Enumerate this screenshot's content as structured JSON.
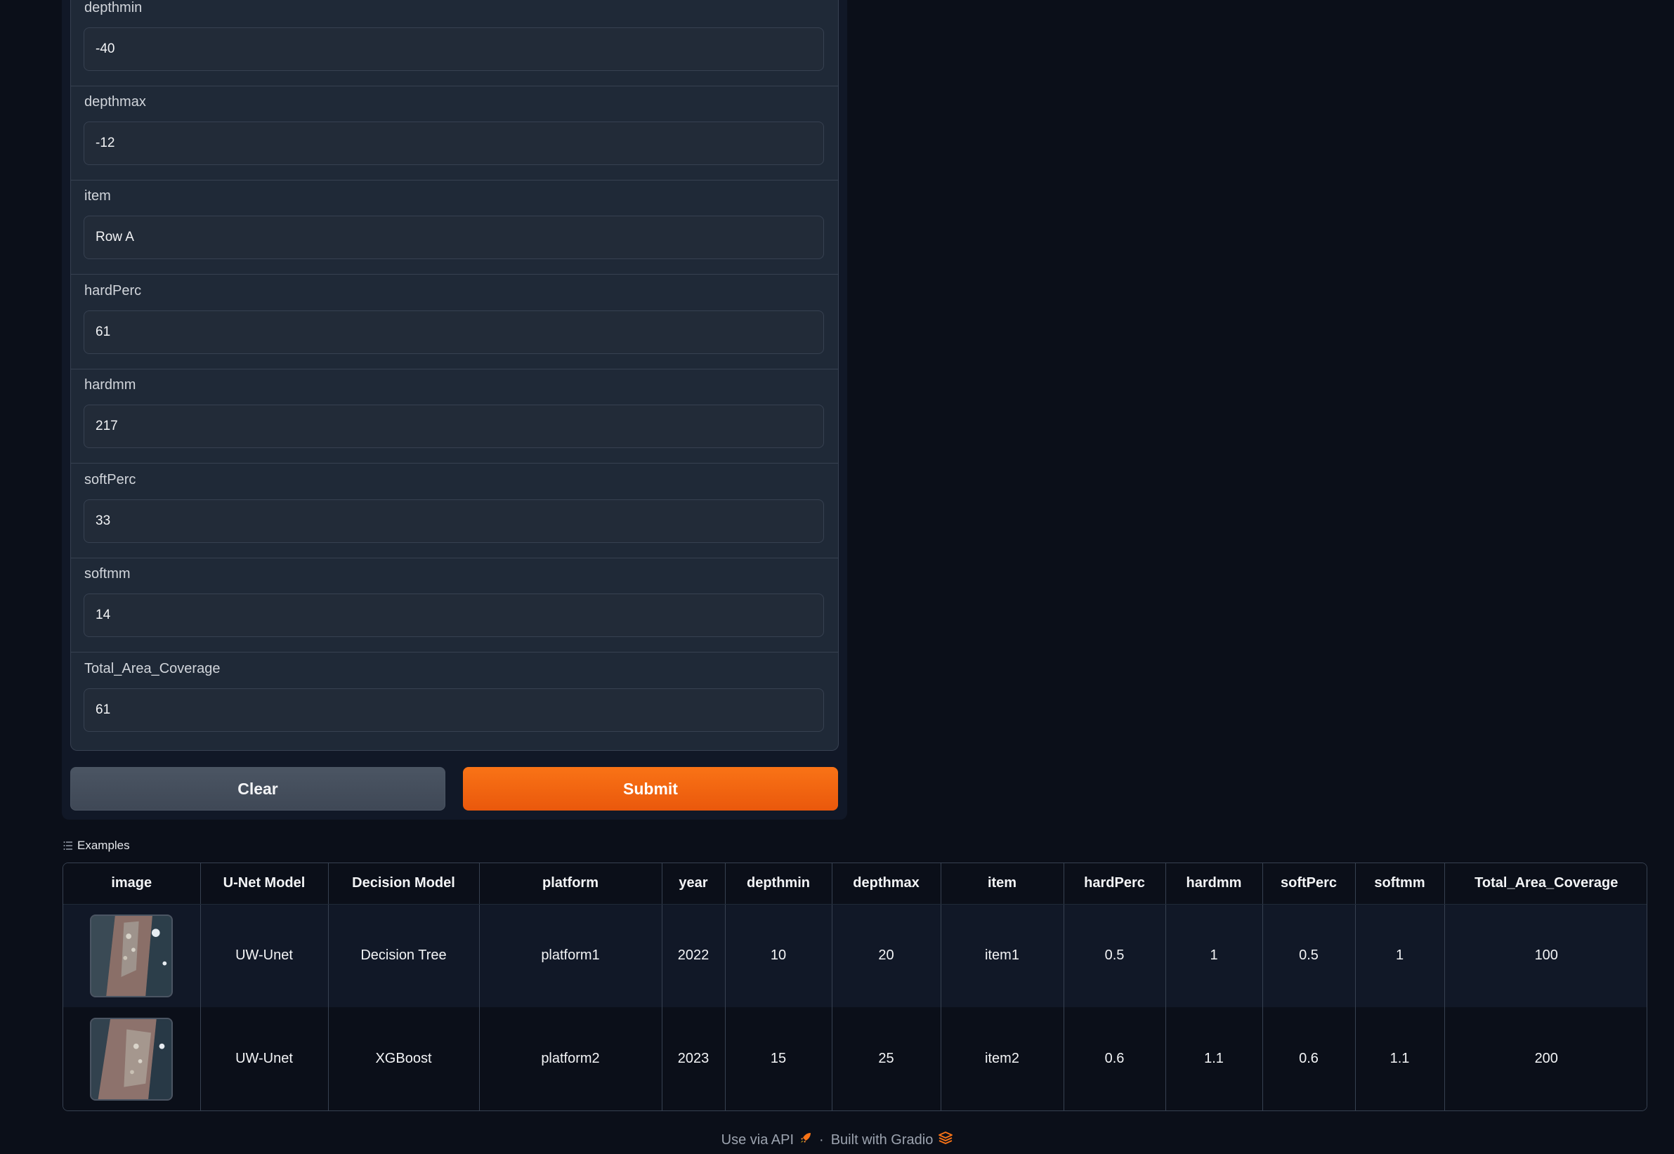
{
  "form": {
    "fields": [
      {
        "label": "depthmin",
        "value": "-40"
      },
      {
        "label": "depthmax",
        "value": "-12"
      },
      {
        "label": "item",
        "value": "Row A"
      },
      {
        "label": "hardPerc",
        "value": "61"
      },
      {
        "label": "hardmm",
        "value": "217"
      },
      {
        "label": "softPerc",
        "value": "33"
      },
      {
        "label": "softmm",
        "value": "14"
      },
      {
        "label": "Total_Area_Coverage",
        "value": "61"
      }
    ],
    "clear_label": "Clear",
    "submit_label": "Submit"
  },
  "examples": {
    "header_label": "Examples",
    "icon": "list-icon",
    "columns": [
      "image",
      "U-Net Model",
      "Decision Model",
      "platform",
      "year",
      "depthmin",
      "depthmax",
      "item",
      "hardPerc",
      "hardmm",
      "softPerc",
      "softmm",
      "Total_Area_Coverage"
    ],
    "rows": [
      {
        "image": "thumbnail-wall-1",
        "unet": "UW-Unet",
        "decision": "Decision Tree",
        "platform": "platform1",
        "year": "2022",
        "depthmin": "10",
        "depthmax": "20",
        "item": "item1",
        "hardPerc": "0.5",
        "hardmm": "1",
        "softPerc": "0.5",
        "softmm": "1",
        "total": "100"
      },
      {
        "image": "thumbnail-wall-2",
        "unet": "UW-Unet",
        "decision": "XGBoost",
        "platform": "platform2",
        "year": "2023",
        "depthmin": "15",
        "depthmax": "25",
        "item": "item2",
        "hardPerc": "0.6",
        "hardmm": "1.1",
        "softPerc": "0.6",
        "softmm": "1.1",
        "total": "200"
      }
    ]
  },
  "footer": {
    "api_label": "Use via API",
    "separator": "·",
    "built_label": "Built with Gradio",
    "api_icon": "rocket-icon",
    "gradio_icon": "gradio-logo-icon"
  },
  "colors": {
    "background": "#0b0f19",
    "panel": "#1f2937",
    "accent": "#f97316",
    "clear_button": "#4b5563"
  }
}
